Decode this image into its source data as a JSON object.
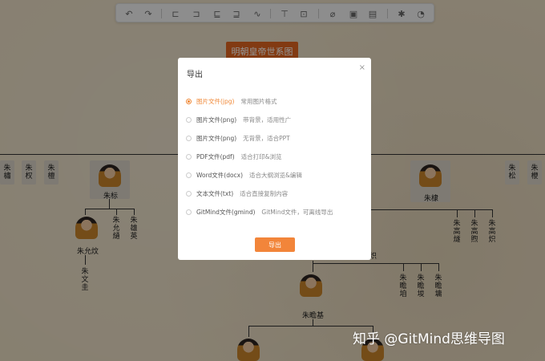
{
  "toolbar": {
    "items": [
      "undo-icon",
      "redo-icon",
      "insert-child-icon",
      "insert-sibling-icon",
      "insert-parent-icon",
      "summary-icon",
      "relation-icon",
      "format-painter-icon",
      "text-icon",
      "link-icon",
      "image-icon",
      "note-icon",
      "magic-icon",
      "clock-icon"
    ]
  },
  "chart_title": "明朝皇帝世系图",
  "tree": {
    "left_names": [
      "朱橚",
      "朱权",
      "朱檀"
    ],
    "zhu_biao": "朱标",
    "zhu_biao_children": [
      "朱允炆",
      "朱允熥",
      "朱雄英"
    ],
    "zhu_wenkui": "朱文圭",
    "zhu_di": "朱棣",
    "zhu_di_children": [
      "朱高燧",
      "朱高煦",
      "朱高炽"
    ],
    "right_names": [
      "朱松",
      "朱楩"
    ],
    "zhu_zhanji": "朱瞻基",
    "zhanji_siblings": [
      "朱瞻垍",
      "朱瞻埈",
      "朱瞻墉"
    ],
    "partial_label": "炽"
  },
  "dialog": {
    "title": "导出",
    "close": "×",
    "options": [
      {
        "label": "图片文件(jpg)",
        "desc": "常用图片格式",
        "checked": true
      },
      {
        "label": "图片文件(png)",
        "desc": "带背景，适用性广",
        "checked": false
      },
      {
        "label": "图片文件(png)",
        "desc": "无背景，适合PPT",
        "checked": false
      },
      {
        "label": "PDF文件(pdf)",
        "desc": "适合打印&浏览",
        "checked": false
      },
      {
        "label": "Word文件(docx)",
        "desc": "适合大纲浏览&编辑",
        "checked": false
      },
      {
        "label": "文本文件(txt)",
        "desc": "适合直接复制内容",
        "checked": false
      },
      {
        "label": "GitMind文件(gmind)",
        "desc": "GitMind文件，可离线导出",
        "checked": false
      }
    ],
    "export_button": "导出"
  },
  "watermark": "知乎 @GitMind思维导图",
  "colors": {
    "accent": "#f08a3a",
    "banner": "#e0651f"
  }
}
